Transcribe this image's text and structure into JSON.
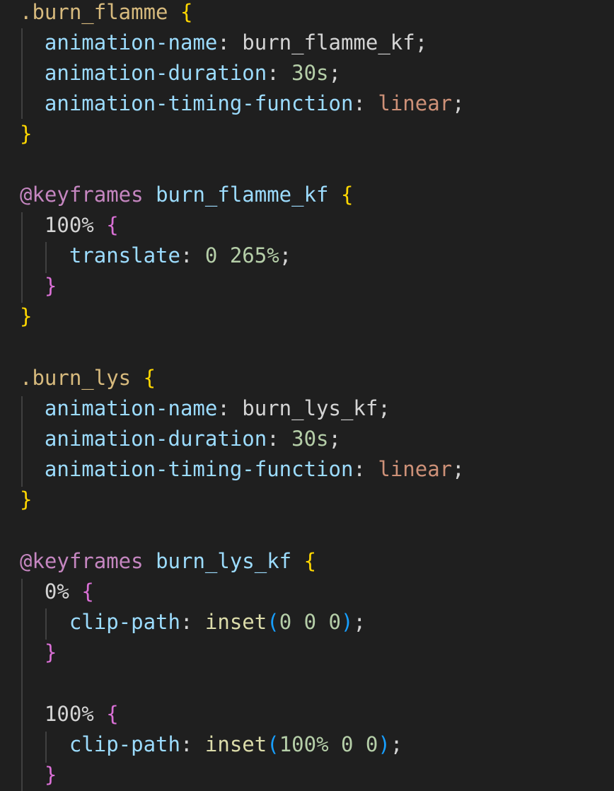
{
  "code": {
    "l1": {
      "selector": ".burn_flamme",
      "brace": "{"
    },
    "l2": {
      "prop": "animation-name",
      "colon": ":",
      "value": "burn_flamme_kf",
      "semi": ";"
    },
    "l3": {
      "prop": "animation-duration",
      "colon": ":",
      "value": "30s",
      "semi": ";"
    },
    "l4": {
      "prop": "animation-timing-function",
      "colon": ":",
      "value": "linear",
      "semi": ";"
    },
    "l5": {
      "brace": "}"
    },
    "l7": {
      "at": "@keyframes",
      "name": "burn_flamme_kf",
      "brace": "{"
    },
    "l8": {
      "key": "100%",
      "brace": "{"
    },
    "l9": {
      "prop": "translate",
      "colon": ":",
      "value": "0 265%",
      "semi": ";"
    },
    "l10": {
      "brace": "}"
    },
    "l11": {
      "brace": "}"
    },
    "l13": {
      "selector": ".burn_lys",
      "brace": "{"
    },
    "l14": {
      "prop": "animation-name",
      "colon": ":",
      "value": "burn_lys_kf",
      "semi": ";"
    },
    "l15": {
      "prop": "animation-duration",
      "colon": ":",
      "value": "30s",
      "semi": ";"
    },
    "l16": {
      "prop": "animation-timing-function",
      "colon": ":",
      "value": "linear",
      "semi": ";"
    },
    "l17": {
      "brace": "}"
    },
    "l19": {
      "at": "@keyframes",
      "name": "burn_lys_kf",
      "brace": "{"
    },
    "l20": {
      "key": "0%",
      "brace": "{"
    },
    "l21": {
      "prop": "clip-path",
      "colon": ":",
      "fn": "inset",
      "open": "(",
      "args": "0 0 0",
      "close": ")",
      "semi": ";"
    },
    "l22": {
      "brace": "}"
    },
    "l24": {
      "key": "100%",
      "brace": "{"
    },
    "l25": {
      "prop": "clip-path",
      "colon": ":",
      "fn": "inset",
      "open": "(",
      "args": "100% 0 0",
      "close": ")",
      "semi": ";"
    },
    "l26": {
      "brace": "}"
    }
  }
}
